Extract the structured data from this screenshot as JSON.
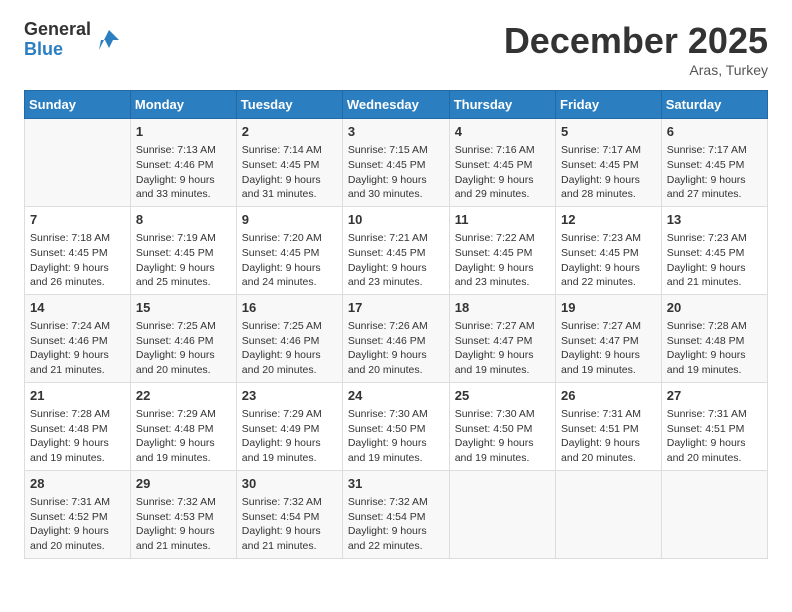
{
  "header": {
    "logo_general": "General",
    "logo_blue": "Blue",
    "month": "December 2025",
    "location": "Aras, Turkey"
  },
  "weekdays": [
    "Sunday",
    "Monday",
    "Tuesday",
    "Wednesday",
    "Thursday",
    "Friday",
    "Saturday"
  ],
  "weeks": [
    [
      {
        "day": "",
        "info": ""
      },
      {
        "day": "1",
        "info": "Sunrise: 7:13 AM\nSunset: 4:46 PM\nDaylight: 9 hours and 33 minutes."
      },
      {
        "day": "2",
        "info": "Sunrise: 7:14 AM\nSunset: 4:45 PM\nDaylight: 9 hours and 31 minutes."
      },
      {
        "day": "3",
        "info": "Sunrise: 7:15 AM\nSunset: 4:45 PM\nDaylight: 9 hours and 30 minutes."
      },
      {
        "day": "4",
        "info": "Sunrise: 7:16 AM\nSunset: 4:45 PM\nDaylight: 9 hours and 29 minutes."
      },
      {
        "day": "5",
        "info": "Sunrise: 7:17 AM\nSunset: 4:45 PM\nDaylight: 9 hours and 28 minutes."
      },
      {
        "day": "6",
        "info": "Sunrise: 7:17 AM\nSunset: 4:45 PM\nDaylight: 9 hours and 27 minutes."
      }
    ],
    [
      {
        "day": "7",
        "info": "Sunrise: 7:18 AM\nSunset: 4:45 PM\nDaylight: 9 hours and 26 minutes."
      },
      {
        "day": "8",
        "info": "Sunrise: 7:19 AM\nSunset: 4:45 PM\nDaylight: 9 hours and 25 minutes."
      },
      {
        "day": "9",
        "info": "Sunrise: 7:20 AM\nSunset: 4:45 PM\nDaylight: 9 hours and 24 minutes."
      },
      {
        "day": "10",
        "info": "Sunrise: 7:21 AM\nSunset: 4:45 PM\nDaylight: 9 hours and 23 minutes."
      },
      {
        "day": "11",
        "info": "Sunrise: 7:22 AM\nSunset: 4:45 PM\nDaylight: 9 hours and 23 minutes."
      },
      {
        "day": "12",
        "info": "Sunrise: 7:23 AM\nSunset: 4:45 PM\nDaylight: 9 hours and 22 minutes."
      },
      {
        "day": "13",
        "info": "Sunrise: 7:23 AM\nSunset: 4:45 PM\nDaylight: 9 hours and 21 minutes."
      }
    ],
    [
      {
        "day": "14",
        "info": "Sunrise: 7:24 AM\nSunset: 4:46 PM\nDaylight: 9 hours and 21 minutes."
      },
      {
        "day": "15",
        "info": "Sunrise: 7:25 AM\nSunset: 4:46 PM\nDaylight: 9 hours and 20 minutes."
      },
      {
        "day": "16",
        "info": "Sunrise: 7:25 AM\nSunset: 4:46 PM\nDaylight: 9 hours and 20 minutes."
      },
      {
        "day": "17",
        "info": "Sunrise: 7:26 AM\nSunset: 4:46 PM\nDaylight: 9 hours and 20 minutes."
      },
      {
        "day": "18",
        "info": "Sunrise: 7:27 AM\nSunset: 4:47 PM\nDaylight: 9 hours and 19 minutes."
      },
      {
        "day": "19",
        "info": "Sunrise: 7:27 AM\nSunset: 4:47 PM\nDaylight: 9 hours and 19 minutes."
      },
      {
        "day": "20",
        "info": "Sunrise: 7:28 AM\nSunset: 4:48 PM\nDaylight: 9 hours and 19 minutes."
      }
    ],
    [
      {
        "day": "21",
        "info": "Sunrise: 7:28 AM\nSunset: 4:48 PM\nDaylight: 9 hours and 19 minutes."
      },
      {
        "day": "22",
        "info": "Sunrise: 7:29 AM\nSunset: 4:48 PM\nDaylight: 9 hours and 19 minutes."
      },
      {
        "day": "23",
        "info": "Sunrise: 7:29 AM\nSunset: 4:49 PM\nDaylight: 9 hours and 19 minutes."
      },
      {
        "day": "24",
        "info": "Sunrise: 7:30 AM\nSunset: 4:50 PM\nDaylight: 9 hours and 19 minutes."
      },
      {
        "day": "25",
        "info": "Sunrise: 7:30 AM\nSunset: 4:50 PM\nDaylight: 9 hours and 19 minutes."
      },
      {
        "day": "26",
        "info": "Sunrise: 7:31 AM\nSunset: 4:51 PM\nDaylight: 9 hours and 20 minutes."
      },
      {
        "day": "27",
        "info": "Sunrise: 7:31 AM\nSunset: 4:51 PM\nDaylight: 9 hours and 20 minutes."
      }
    ],
    [
      {
        "day": "28",
        "info": "Sunrise: 7:31 AM\nSunset: 4:52 PM\nDaylight: 9 hours and 20 minutes."
      },
      {
        "day": "29",
        "info": "Sunrise: 7:32 AM\nSunset: 4:53 PM\nDaylight: 9 hours and 21 minutes."
      },
      {
        "day": "30",
        "info": "Sunrise: 7:32 AM\nSunset: 4:54 PM\nDaylight: 9 hours and 21 minutes."
      },
      {
        "day": "31",
        "info": "Sunrise: 7:32 AM\nSunset: 4:54 PM\nDaylight: 9 hours and 22 minutes."
      },
      {
        "day": "",
        "info": ""
      },
      {
        "day": "",
        "info": ""
      },
      {
        "day": "",
        "info": ""
      }
    ]
  ]
}
